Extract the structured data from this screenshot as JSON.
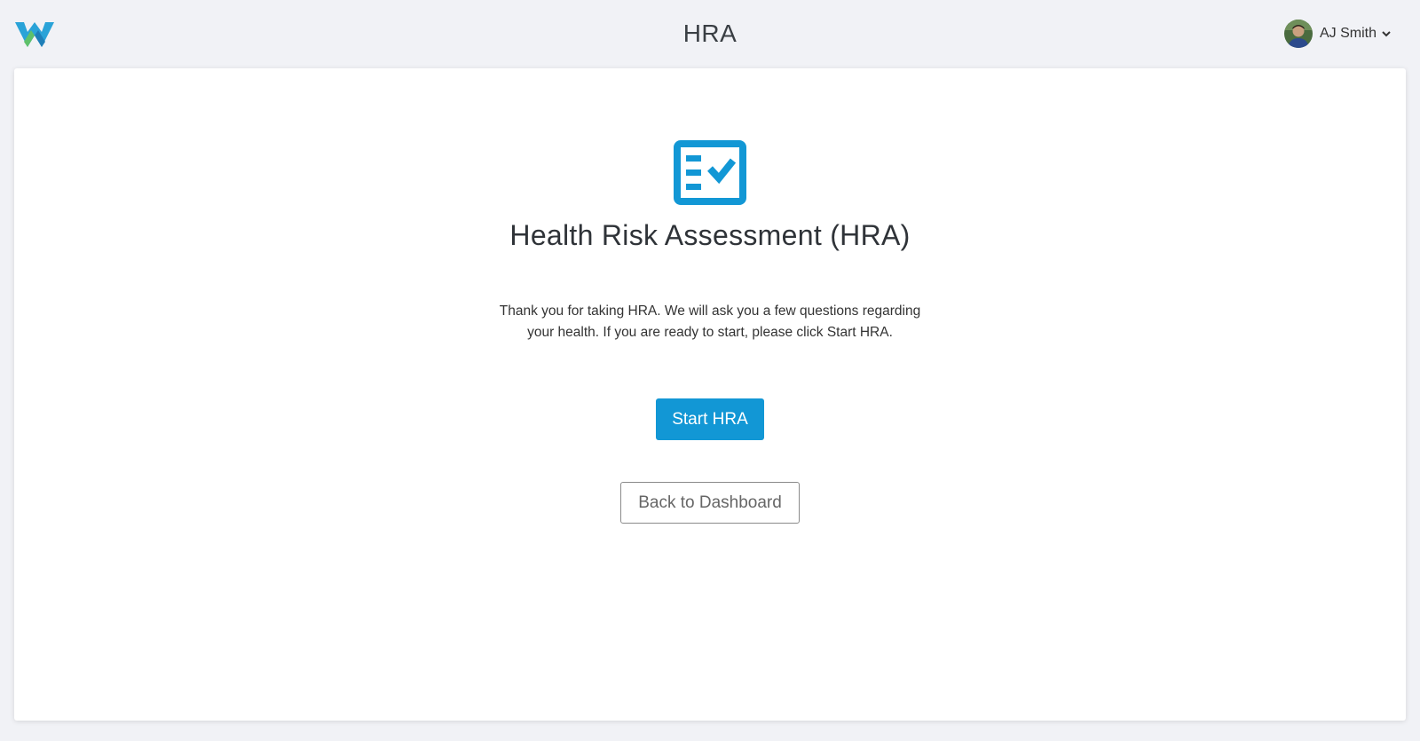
{
  "header": {
    "logo_icon": "w-logo-icon",
    "title": "HRA",
    "user": {
      "name": "AJ Smith",
      "avatar_icon": "user-avatar",
      "menu_icon": "chevron-down-icon"
    }
  },
  "main": {
    "icon": "checklist-icon",
    "heading": "Health Risk Assessment (HRA)",
    "intro": "Thank you for taking HRA. We will ask you a few questions regarding your health. If you are ready to start, please click Start HRA.",
    "start_button": "Start HRA",
    "back_button": "Back to Dashboard"
  },
  "colors": {
    "accent": "#1297d5",
    "background": "#f1f2f6",
    "card": "#ffffff"
  }
}
